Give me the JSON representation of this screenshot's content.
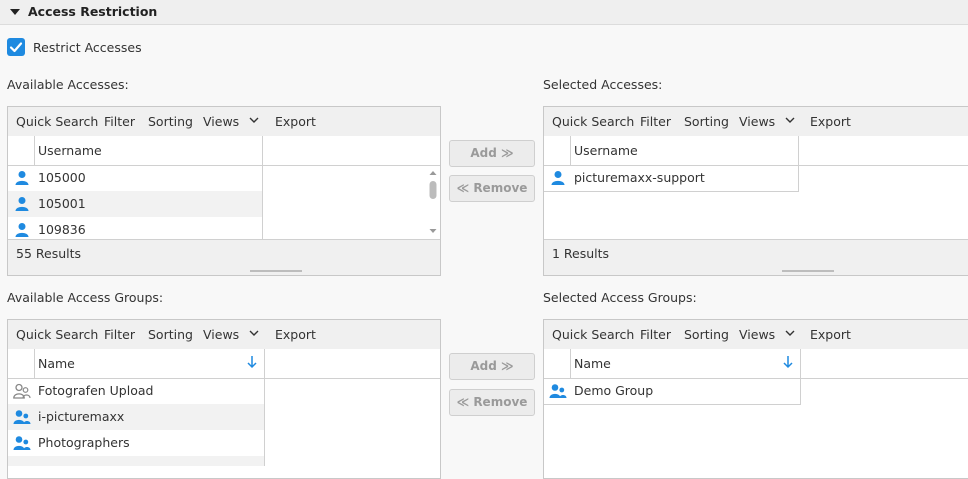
{
  "section": {
    "title": "Access Restriction"
  },
  "restrict": {
    "label": "Restrict Accesses",
    "checked": true
  },
  "toolbar_labels": {
    "quick_search": "Quick Search",
    "filter": "Filter",
    "sorting": "Sorting",
    "views": "Views",
    "export": "Export"
  },
  "available_accesses": {
    "label": "Available Accesses:",
    "column": "Username",
    "rows": [
      "105000",
      "105001",
      "109836"
    ],
    "results": "55 Results"
  },
  "selected_accesses": {
    "label": "Selected Accesses:",
    "column": "Username",
    "rows": [
      "picturemaxx-support"
    ],
    "results": "1 Results"
  },
  "available_groups": {
    "label": "Available Access Groups:",
    "column": "Name",
    "rows": [
      "Fotografen Upload",
      "i-picturemaxx",
      "Photographers"
    ]
  },
  "selected_groups": {
    "label": "Selected Access Groups:",
    "column": "Name",
    "rows": [
      "Demo Group"
    ]
  },
  "buttons": {
    "add": "Add ≫",
    "remove": "≪ Remove"
  },
  "colors": {
    "accent": "#1f8ae0",
    "header_bg": "#efefef",
    "toolbar_bg": "#f0f0f0"
  }
}
